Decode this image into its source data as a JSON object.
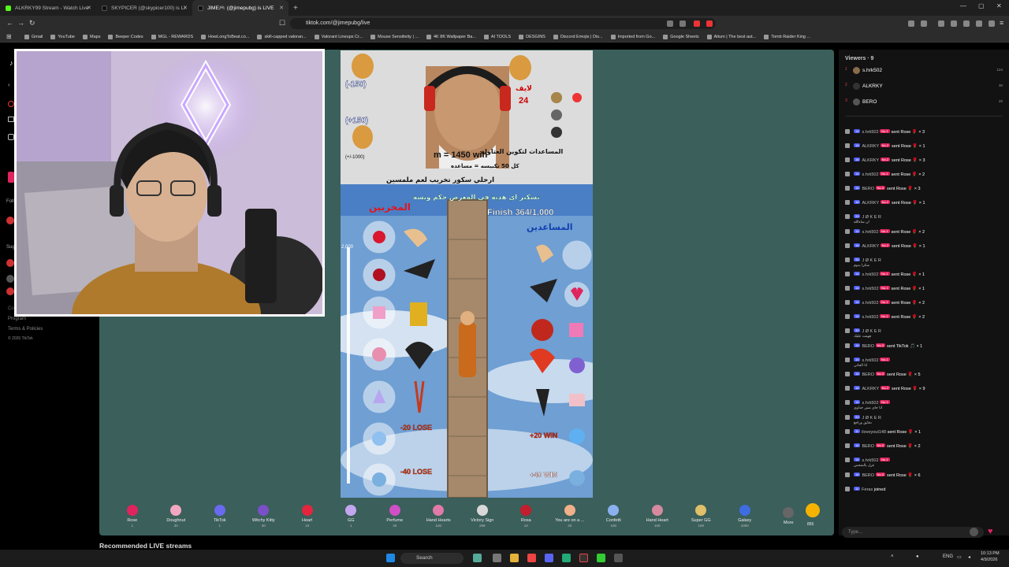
{
  "browser": {
    "tabs": [
      {
        "title": "ALKRKY99 Stream - Watch Live on K..."
      },
      {
        "title": "SKYPICER (@skypicer100) is LIVE - Ti..."
      },
      {
        "title": "JIME🎮 (@jimepubg) is LIVE"
      }
    ],
    "url": "tiktok.com/@jimepubg/live",
    "bookmarks": [
      "Gmail",
      "YouTube",
      "Maps",
      "Beeper Codes",
      "MGL - REWARDS",
      "HowLongToBeat.co...",
      "skill-capped valoran...",
      "Valorant Lineups Cr...",
      "Mouse Sensitivity | ...",
      "4K 8K Wallpaper Ba...",
      "AI TOOLS",
      "DESGINS",
      "Discord Emojis | Dis...",
      "Imported from Go...",
      "Google Sheets",
      "Aitum | The best aut...",
      "Tomb Raider King ..."
    ]
  },
  "leftnav": {
    "program": "Program",
    "terms": "Terms & Policies",
    "copyright": "© 2026 TikTok"
  },
  "game": {
    "score_minus": "(-150)",
    "score_plus": "(+150)",
    "score_range": "(+/-1000)",
    "level_tag": "لايف",
    "level_value": "24",
    "target_line": "m = 1450 win",
    "arabic_line1": "المساعدات لتكوين العتاولة",
    "arabic_line2": "كل 50 تكبيسه = مساعده",
    "arabic_line3": "ارحلي سكور تخريب لعم ملمسين",
    "arabic_line4": "تسكير اي هدية في المعرض حكم ونسة",
    "saboteurs": "المخربين",
    "helpers": "المساعدين",
    "finish_label": "Finish 364/1,000",
    "meter_top": "2,000",
    "lose_label": "-20 LOSE",
    "lose_label2": "-40 LOSE",
    "win_label": "+20 WIN",
    "win_label2": "+40 WIN"
  },
  "gifts": [
    {
      "name": "Rose",
      "price": "1",
      "color": "#e0245e"
    },
    {
      "name": "Doughnut",
      "price": "30",
      "color": "#f2a7c0"
    },
    {
      "name": "TikTok",
      "price": "1",
      "color": "#6a6af0"
    },
    {
      "name": "Witchy Kitty",
      "price": "30",
      "color": "#7a50c8"
    },
    {
      "name": "Heart",
      "price": "10",
      "color": "#e3263e"
    },
    {
      "name": "GG",
      "price": "1",
      "color": "#c3a6f0"
    },
    {
      "name": "Perfume",
      "price": "20",
      "color": "#d04fc7"
    },
    {
      "name": "Hand Hearts",
      "price": "100",
      "color": "#e07aa8"
    },
    {
      "name": "Victory Sign",
      "price": "299",
      "color": "#d8d8d8"
    },
    {
      "name": "Rosa",
      "price": "10",
      "color": "#c21e2e"
    },
    {
      "name": "You are on a ...",
      "price": "20",
      "color": "#f0b08a"
    },
    {
      "name": "Confetti",
      "price": "100",
      "color": "#8ab0f0"
    },
    {
      "name": "Hand Heart",
      "price": "100",
      "color": "#d58aa0"
    },
    {
      "name": "Super GG",
      "price": "100",
      "color": "#e0c06a"
    },
    {
      "name": "Galaxy",
      "price": "1000",
      "color": "#3d6de0"
    },
    {
      "name": "More",
      "price": "",
      "color": "#666666"
    }
  ],
  "coins": {
    "value": "855"
  },
  "recommended": "Recommended LIVE streams",
  "chat": {
    "viewers_label": "Viewers · 9",
    "top_viewers": [
      {
        "rank": "1",
        "name": "s.hrk502",
        "score": "124"
      },
      {
        "rank": "2",
        "name": "ALKRKY",
        "score": "30"
      },
      {
        "rank": "3",
        "name": "BERO",
        "score": "20"
      }
    ],
    "messages": [
      {
        "lvl": "14",
        "name": "s.hrk502",
        "no": "No.1",
        "text": "sent Rose 🌹 × 3",
        "sub": ""
      },
      {
        "lvl": "16",
        "name": "ALKRKY",
        "no": "No.2",
        "text": "sent Rose 🌹 × 1",
        "sub": ""
      },
      {
        "lvl": "16",
        "name": "ALKRKY",
        "no": "No.2",
        "text": "sent Rose 🌹 × 3",
        "sub": ""
      },
      {
        "lvl": "14",
        "name": "s.hrk502",
        "no": "No.1",
        "text": "sent Rose 🌹 × 2",
        "sub": ""
      },
      {
        "lvl": "16",
        "name": "BERO",
        "no": "No.3",
        "text": "sent Rose 🌹 × 3",
        "sub": ""
      },
      {
        "lvl": "16",
        "name": "ALKRKY",
        "no": "No.2",
        "text": "sent Rose 🌹 × 1",
        "sub": ""
      },
      {
        "lvl": "33",
        "name": "J Ø K E R",
        "no": "",
        "text": "",
        "sub": "ان شاءالله"
      },
      {
        "lvl": "14",
        "name": "s.hrk502",
        "no": "No.1",
        "text": "sent Rose 🌹 × 2",
        "sub": ""
      },
      {
        "lvl": "16",
        "name": "ALKRKY",
        "no": "No.2",
        "text": "sent Rose 🌹 × 1",
        "sub": ""
      },
      {
        "lvl": "33",
        "name": "J Ø K E R",
        "no": "",
        "text": "",
        "sub": "شكرا يدوم"
      },
      {
        "lvl": "14",
        "name": "s.hrk502",
        "no": "No.1",
        "text": "sent Rose 🌹 × 1",
        "sub": ""
      },
      {
        "lvl": "14",
        "name": "s.hrk502",
        "no": "No.1",
        "text": "sent Rose 🌹 × 1",
        "sub": ""
      },
      {
        "lvl": "14",
        "name": "s.hrk502",
        "no": "No.1",
        "text": "sent Rose 🌹 × 2",
        "sub": ""
      },
      {
        "lvl": "14",
        "name": "s.hrk502",
        "no": "No.1",
        "text": "sent Rose 🌹 × 2",
        "sub": ""
      },
      {
        "lvl": "33",
        "name": "J Ø K E R",
        "no": "",
        "text": "",
        "sub": "فهمت عليك"
      },
      {
        "lvl": "16",
        "name": "BERO",
        "no": "No.3",
        "text": "sent TikTok 🎵 × 1",
        "sub": ""
      },
      {
        "lvl": "14",
        "name": "s.hrk502",
        "no": "No.1",
        "text": "",
        "sub": "انا الجاني"
      },
      {
        "lvl": "16",
        "name": "BERO",
        "no": "No.3",
        "text": "sent Rose 🌹 × 5",
        "sub": ""
      },
      {
        "lvl": "16",
        "name": "ALKRKY",
        "no": "No.2",
        "text": "sent Rose 🌹 × 9",
        "sub": ""
      },
      {
        "lvl": "14",
        "name": "s.hrk502",
        "no": "No.1",
        "text": "",
        "sub": "انا جاي مش جداوي"
      },
      {
        "lvl": "33",
        "name": "J Ø K E R",
        "no": "",
        "text": "",
        "sub": "دقايق وراجع"
      },
      {
        "lvl": "11",
        "name": "iloveyout148",
        "no": "",
        "text": "sent Rose 🌹 × 1",
        "sub": ""
      },
      {
        "lvl": "16",
        "name": "BERO",
        "no": "No.3",
        "text": "sent Rose 🌹 × 2",
        "sub": ""
      },
      {
        "lvl": "14",
        "name": "s.hrk502",
        "no": "No.1",
        "text": "",
        "sub": "غزل يالمنحس"
      },
      {
        "lvl": "16",
        "name": "BERO",
        "no": "No.3",
        "text": "sent Rose 🌹 × 6",
        "sub": ""
      },
      {
        "lvl": "11",
        "name": "Feras",
        "no": "",
        "text": "joined",
        "sub": ""
      }
    ],
    "input_placeholder": "Type..."
  },
  "taskbar": {
    "search": "Search",
    "lang": "ENG",
    "time": "10:13 PM",
    "date": "4/9/2026"
  },
  "colors": {
    "stage": "#3b5f5a",
    "chat_bg": "#121212",
    "level_badge": "#4f5cf0",
    "rank_badge": "#e0245e"
  }
}
